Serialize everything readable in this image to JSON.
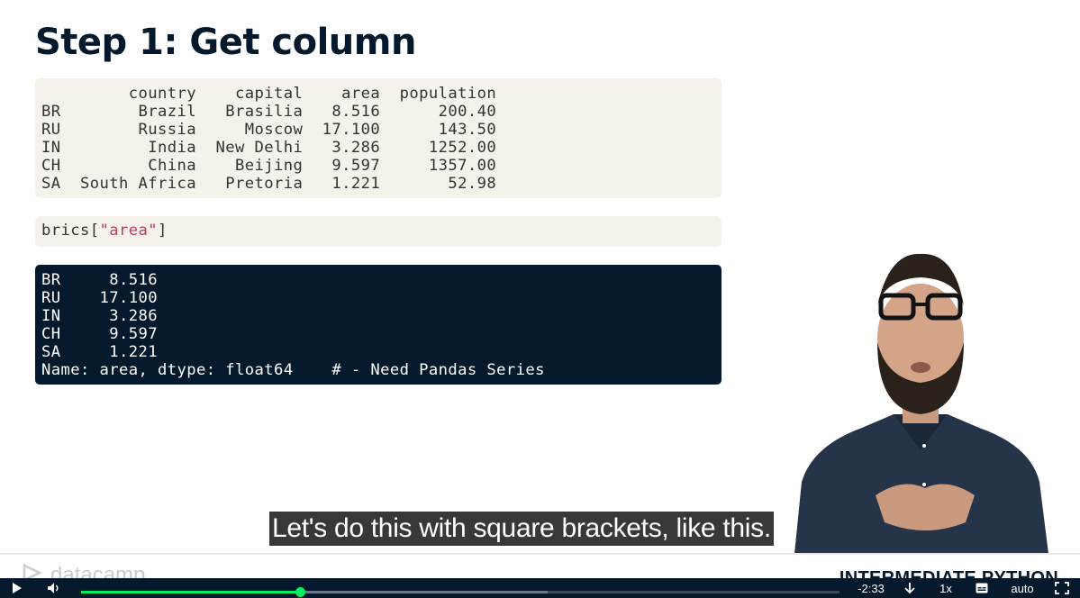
{
  "slide": {
    "title": "Step 1: Get column",
    "dataframe_text": "         country    capital    area  population\nBR        Brazil   Brasilia   8.516      200.40\nRU        Russia     Moscow  17.100      143.50\nIN         India  New Delhi   3.286     1252.00\nCH         China    Beijing   9.597     1357.00\nSA  South Africa   Pretoria   1.221       52.98",
    "command": {
      "prefix": "brics[",
      "string": "\"area\"",
      "suffix": "]"
    },
    "output_text": "BR     8.516\nRU    17.100\nIN     3.286\nCH     9.597\nSA     1.221\nName: area, dtype: float64    # - Need Pandas Series",
    "footer": {
      "logo_text": "datacamp",
      "course_title": "INTERMEDIATE PYTHON"
    }
  },
  "caption": "Let's do this with square brackets, like this.",
  "player": {
    "time_remaining": "-2:33",
    "speed": "1x",
    "quality": "auto",
    "progress_fraction": 0.289,
    "buffered_fraction": 0.615,
    "icons": {
      "play": "play-icon",
      "volume": "volume-icon",
      "download": "download-icon",
      "subtitles": "subtitles-icon",
      "fullscreen": "fullscreen-icon"
    },
    "accent_color": "#03ef62",
    "bar_color": "#05192d"
  }
}
